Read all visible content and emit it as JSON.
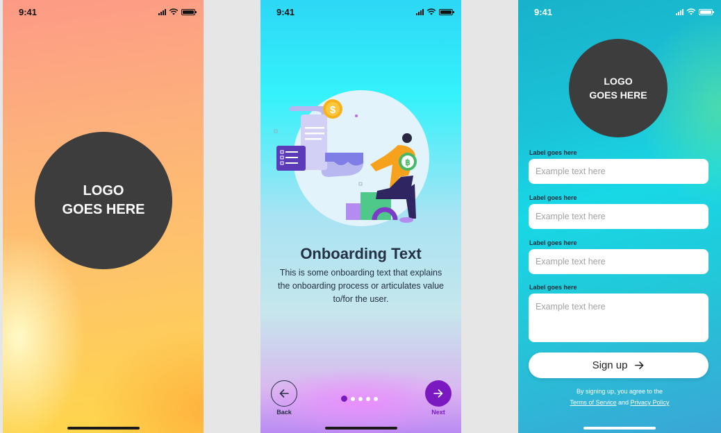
{
  "splash": {
    "time": "9:41",
    "logo": "LOGO\nGOES HERE"
  },
  "onboarding": {
    "time": "9:41",
    "title": "Onboarding Text",
    "body": "This is some onboarding text that explains the onboarding process or articulates value to/for the user.",
    "back_label": "Back",
    "next_label": "Next",
    "page_count": 5,
    "active_page": 1,
    "accent": "#7b19c1",
    "illustration_coin_symbol": "$"
  },
  "signup": {
    "time": "9:41",
    "logo": "LOGO\nGOES HERE",
    "fields": [
      {
        "label": "Label goes here",
        "placeholder": "Example text here"
      },
      {
        "label": "Label goes here",
        "placeholder": "Example text here"
      },
      {
        "label": "Label goes here",
        "placeholder": "Example text here"
      },
      {
        "label": "Label goes here",
        "placeholder": "Example text here"
      }
    ],
    "button_label": "Sign up",
    "terms_prefix": "By signing up, you agree to the",
    "terms_link": "Terms of Service",
    "terms_and": "and",
    "privacy_link": "Privacy Policy"
  }
}
